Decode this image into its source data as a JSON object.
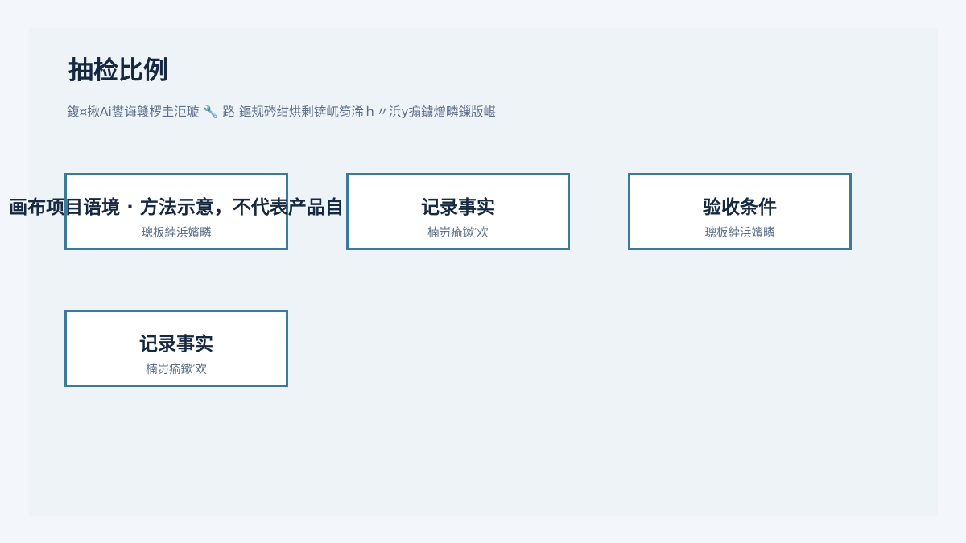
{
  "header": {
    "title": "抽检比例",
    "subtitle": "鍑¤揪Ai鐢诲竷椤圭洰璇 🔧 路  鏂规硶绀烘剰锛屼笉浠ｈ〃浜у搧鐪熷疄鏁版嵁"
  },
  "boxes": [
    {
      "main": "画布项目语境 · 方法示意，不代表产品自",
      "sub": "璁板綍浜嬪疄"
    },
    {
      "main": "记录事实",
      "sub": "楠岃瘉鏉′欢"
    },
    {
      "main": "验收条件",
      "sub": "璁板綍浜嬪疄"
    },
    {
      "main": "记录事实",
      "sub": "楠岃瘉鏉′欢"
    }
  ],
  "colors": {
    "page_background": "#f3f7fb",
    "panel_background": "#eef3f8",
    "box_border": "#3b7a99",
    "title_text": "#16283f",
    "muted_text": "#5b6f88"
  }
}
